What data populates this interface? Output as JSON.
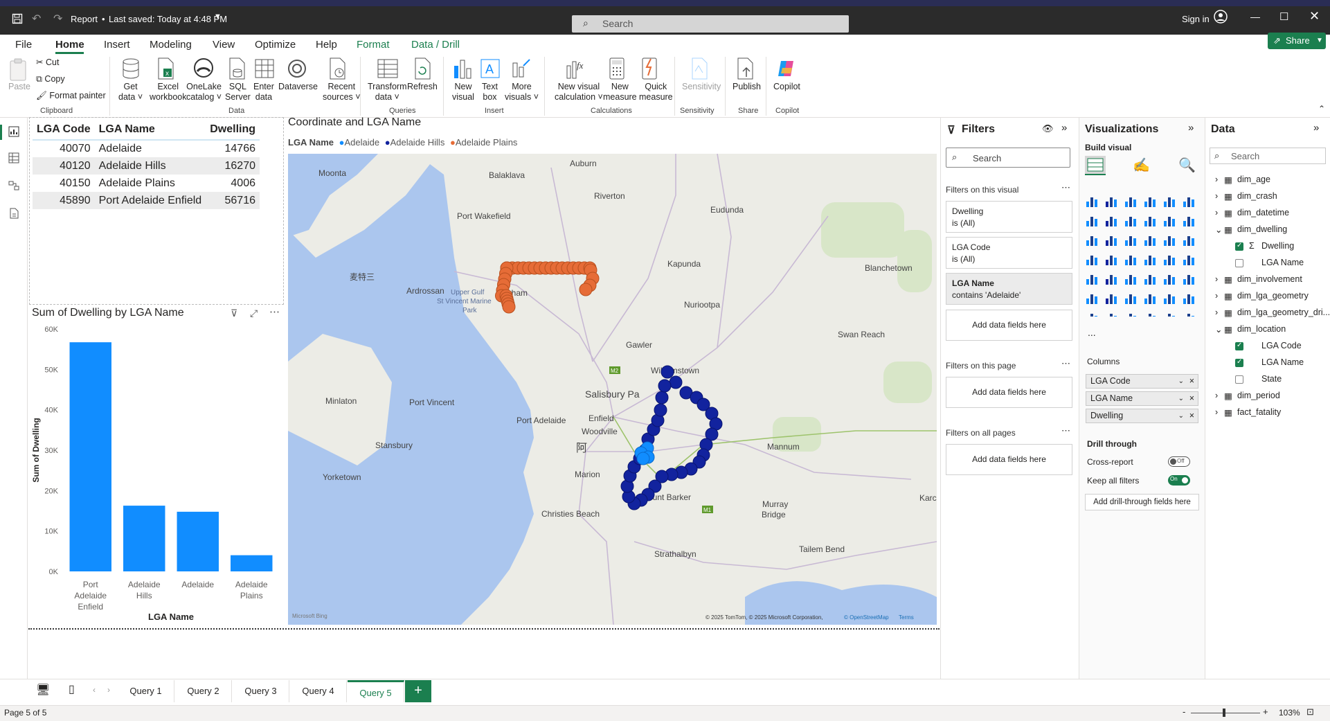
{
  "titlebar": {
    "title": "Report",
    "saved": "Last saved: Today at 4:48 PM",
    "search_placeholder": "Search",
    "sign_in": "Sign in"
  },
  "menu": {
    "tabs": [
      "File",
      "Home",
      "Insert",
      "Modeling",
      "View",
      "Optimize",
      "Help",
      "Format",
      "Data / Drill"
    ],
    "share": "Share"
  },
  "ribbon": {
    "clipboard": {
      "paste": "Paste",
      "cut": "Cut",
      "copy": "Copy",
      "format_painter": "Format painter",
      "group": "Clipboard"
    },
    "data": {
      "get_data": "Get",
      "get_data2": "data",
      "excel": "Excel",
      "excel2": "workbook",
      "onelake": "OneLake",
      "onelake2": "catalog",
      "sql": "SQL",
      "sql2": "Server",
      "enter": "Enter",
      "enter2": "data",
      "dataverse": "Dataverse",
      "recent": "Recent",
      "recent2": "sources",
      "group": "Data"
    },
    "queries": {
      "transform": "Transform",
      "transform2": "data",
      "refresh": "Refresh",
      "group": "Queries"
    },
    "insert": {
      "new_visual": "New",
      "new_visual2": "visual",
      "text_box": "Text",
      "text_box2": "box",
      "more": "More",
      "more2": "visuals",
      "group": "Insert"
    },
    "calculations": {
      "nvc": "New visual",
      "nvc2": "calculation",
      "nm": "New",
      "nm2": "measure",
      "qm": "Quick",
      "qm2": "measure",
      "group": "Calculations"
    },
    "sensitivity": {
      "label": "Sensitivity",
      "group": "Sensitivity"
    },
    "share": {
      "publish": "Publish",
      "group": "Share"
    },
    "copilot": {
      "label": "Copilot",
      "group": "Copilot"
    }
  },
  "table": {
    "headers": [
      "LGA Code",
      "LGA Name",
      "Dwelling"
    ],
    "rows": [
      [
        "40070",
        "Adelaide",
        "14766"
      ],
      [
        "40120",
        "Adelaide Hills",
        "16270"
      ],
      [
        "40150",
        "Adelaide Plains",
        "4006"
      ],
      [
        "45890",
        "Port Adelaide Enfield",
        "56716"
      ]
    ]
  },
  "chart_data": {
    "type": "bar",
    "title": "Sum of Dwelling by LGA Name",
    "xlabel": "LGA Name",
    "ylabel": "Sum of Dwelling",
    "categories": [
      "Port Adelaide Enfield",
      "Adelaide Hills",
      "Adelaide",
      "Adelaide Plains"
    ],
    "category_lines": [
      [
        "Port",
        "Adelaide",
        "Enfield"
      ],
      [
        "Adelaide",
        "Hills"
      ],
      [
        "Adelaide"
      ],
      [
        "Adelaide",
        "Plains"
      ]
    ],
    "values": [
      56716,
      16270,
      14766,
      4006
    ],
    "ylim": [
      0,
      60000
    ],
    "yticks": [
      "0K",
      "10K",
      "20K",
      "30K",
      "40K",
      "50K",
      "60K"
    ],
    "color": "#118dff"
  },
  "map": {
    "title": "Coordinate and LGA Name",
    "legend_title": "LGA Name",
    "legend": [
      {
        "name": "Adelaide",
        "color": "#118dff"
      },
      {
        "name": "Adelaide Hills",
        "color": "#12239e"
      },
      {
        "name": "Adelaide Plains",
        "color": "#e66c37"
      }
    ],
    "places": [
      "Moonta",
      "Auburn",
      "Balaklava",
      "Riverton",
      "Eudunda",
      "Port Wakefield",
      "Kapunda",
      "Blanchetown",
      "麦特三",
      "Ardrossan",
      "Upper Gulf",
      "St Vincent Marine",
      "Park",
      "Parham",
      "Nuriootpa",
      "Gawler",
      "Williamstown",
      "Swan Reach",
      "Minlaton",
      "Port Vincent",
      "Salisbury Pa",
      "Port Adelaide",
      "Enfield",
      "Woodville",
      "阿",
      "Stansbury",
      "Mannum",
      "Yorketown",
      "Marion",
      "Mount Barker",
      "Christies Beach",
      "Murray",
      "Bridge",
      "Karc",
      "Strathalbyn",
      "Tailem Bend",
      "M2",
      "M1"
    ],
    "attribution": "© 2025 TomTom, © 2025 Microsoft Corporation,",
    "osm": "© OpenStreetMap",
    "terms": "Terms",
    "bing": "Microsoft Bing"
  },
  "filters": {
    "title": "Filters",
    "search": "Search",
    "on_visual": "Filters on this visual",
    "cards": [
      {
        "field": "Dwelling",
        "cond": "is (All)"
      },
      {
        "field": "LGA Code",
        "cond": "is (All)"
      },
      {
        "field": "LGA Name",
        "cond": "contains 'Adelaide'"
      }
    ],
    "add": "Add data fields here",
    "on_page": "Filters on this page",
    "on_all": "Filters on all pages"
  },
  "viz": {
    "title": "Visualizations",
    "build": "Build visual",
    "columns": "Columns",
    "wells": [
      "LGA Code",
      "LGA Name",
      "Dwelling"
    ],
    "drill": "Drill through",
    "cross": "Cross-report",
    "cross_state": "Off",
    "keep": "Keep all filters",
    "keep_state": "On",
    "add_drill": "Add drill-through fields here",
    "more": "..."
  },
  "data_pane": {
    "title": "Data",
    "search": "Search",
    "items": [
      "dim_age",
      "dim_crash",
      "dim_datetime",
      "dim_dwelling",
      "Dwelling",
      "LGA Name",
      "dim_involvement",
      "dim_lga_geometry",
      "dim_lga_geometry_dri...",
      "dim_location",
      "LGA Code",
      "LGA Name",
      "State",
      "dim_period",
      "fact_fatality"
    ]
  },
  "pages": {
    "tabs": [
      "Query 1",
      "Query 2",
      "Query 3",
      "Query 4",
      "Query 5"
    ],
    "active": "Query 5",
    "add": "+"
  },
  "status": {
    "page": "Page 5 of 5",
    "zoom": "103%",
    "minus": "-",
    "plus": "+"
  }
}
